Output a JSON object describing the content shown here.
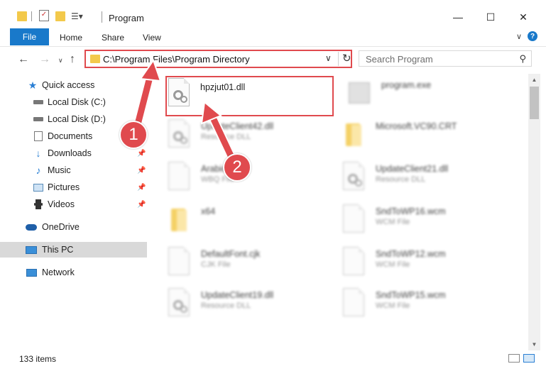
{
  "window": {
    "title": "Program",
    "minimize_icon": "minimize-icon",
    "maximize_icon": "maximize-icon",
    "close_icon": "close-icon"
  },
  "ribbon": {
    "file": "File",
    "home": "Home",
    "share": "Share",
    "view": "View",
    "help": "?"
  },
  "navigation": {
    "address": "C:\\Program Files\\Program Directory",
    "search_placeholder": "Search Program"
  },
  "sidebar": {
    "items": [
      {
        "label": "Quick access",
        "icon": "star-icon",
        "pinned": false
      },
      {
        "label": "Local Disk (C:)",
        "icon": "drive-icon",
        "pinned": false
      },
      {
        "label": "Local Disk (D:)",
        "icon": "drive-icon",
        "pinned": false
      },
      {
        "label": "Documents",
        "icon": "documents-icon",
        "pinned": false
      },
      {
        "label": "Downloads",
        "icon": "download-icon",
        "pinned": true
      },
      {
        "label": "Music",
        "icon": "music-icon",
        "pinned": true
      },
      {
        "label": "Pictures",
        "icon": "pictures-icon",
        "pinned": true
      },
      {
        "label": "Videos",
        "icon": "videos-icon",
        "pinned": true
      },
      {
        "label": "OneDrive",
        "icon": "cloud-icon",
        "pinned": false
      },
      {
        "label": "This PC",
        "icon": "computer-icon",
        "pinned": false,
        "selected": true
      },
      {
        "label": "Network",
        "icon": "network-icon",
        "pinned": false
      }
    ]
  },
  "files": [
    {
      "name": "hpzjut01.dll",
      "type": "",
      "icon": "dll-icon",
      "highlighted": true
    },
    {
      "name": "program.exe",
      "type": "",
      "icon": "exe-icon"
    },
    {
      "name": "UpdateClient42.dll",
      "type": "Resource DLL",
      "icon": "dll-icon"
    },
    {
      "name": "Microsoft.VC90.CRT",
      "type": "",
      "icon": "folder-icon"
    },
    {
      "name": "Arabic",
      "type": "WBQ File",
      "icon": "file-icon"
    },
    {
      "name": "UpdateClient21.dll",
      "type": "Resource DLL",
      "icon": "dll-icon"
    },
    {
      "name": "x64",
      "type": "",
      "icon": "folder-icon"
    },
    {
      "name": "SndToWP16.wcm",
      "type": "WCM File",
      "icon": "file-icon"
    },
    {
      "name": "DefaultFont.cjk",
      "type": "CJK File",
      "icon": "file-icon"
    },
    {
      "name": "SndToWP12.wcm",
      "type": "WCM File",
      "icon": "file-icon"
    },
    {
      "name": "UpdateClient19.dll",
      "type": "Resource DLL",
      "icon": "dll-icon"
    },
    {
      "name": "SndToWP15.wcm",
      "type": "WCM File",
      "icon": "file-icon"
    }
  ],
  "status": {
    "item_count": "133 items"
  },
  "callouts": [
    "1",
    "2"
  ],
  "colors": {
    "accent": "#1979ca",
    "highlight": "#e04a4e",
    "folder": "#f3c94b"
  }
}
